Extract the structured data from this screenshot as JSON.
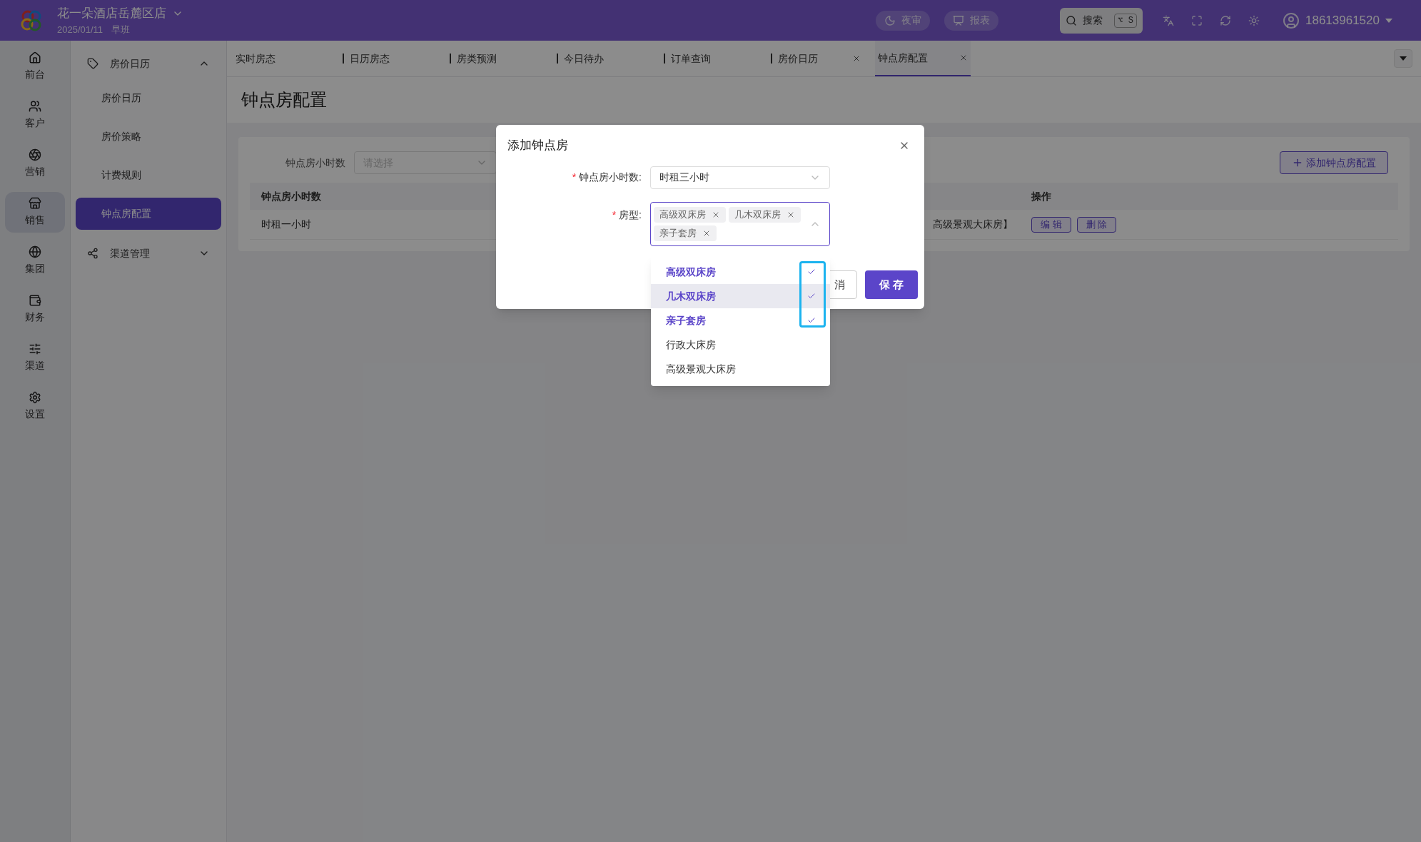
{
  "header": {
    "hotel_name": "花一朵酒店岳麓区店",
    "date": "2025/01/11",
    "shift": "早班",
    "actions": [
      {
        "kind": "night",
        "label": "夜审"
      },
      {
        "kind": "report",
        "label": "报表"
      }
    ],
    "search": {
      "label": "搜索",
      "shortcut": "⌥ S"
    },
    "user": "18613961520"
  },
  "rail": [
    {
      "kind": "front",
      "label": "前台",
      "selected": false
    },
    {
      "kind": "customer",
      "label": "客户",
      "selected": false
    },
    {
      "kind": "marketing",
      "label": "营销",
      "selected": false
    },
    {
      "kind": "sales",
      "label": "销售",
      "selected": true
    },
    {
      "kind": "group",
      "label": "集团",
      "selected": false
    },
    {
      "kind": "finance",
      "label": "财务",
      "selected": false
    },
    {
      "kind": "channel",
      "label": "渠道",
      "selected": false
    },
    {
      "kind": "settings",
      "label": "设置",
      "selected": false
    }
  ],
  "submenu": [
    {
      "kind": "tag",
      "label": "房价日历",
      "expanded": true,
      "children": [
        {
          "label": "房价日历",
          "selected": false
        },
        {
          "label": "房价策略",
          "selected": false
        },
        {
          "label": "计费规则",
          "selected": false
        },
        {
          "label": "钟点房配置",
          "selected": true
        }
      ]
    },
    {
      "kind": "share",
      "label": "渠道管理",
      "expanded": false
    }
  ],
  "tabs": [
    {
      "label": "实时房态",
      "selected": false,
      "closable": false
    },
    {
      "label": "日历房态",
      "selected": false,
      "closable": false
    },
    {
      "label": "房类预测",
      "selected": false,
      "closable": false
    },
    {
      "label": "今日待办",
      "selected": false,
      "closable": false
    },
    {
      "label": "订单查询",
      "selected": false,
      "closable": false
    },
    {
      "label": "房价日历",
      "selected": false,
      "closable": true
    },
    {
      "label": "钟点房配置",
      "selected": true,
      "closable": true
    }
  ],
  "page_title": "钟点房配置",
  "filter": {
    "label": "钟点房小时数",
    "placeholder": "请选择"
  },
  "add_button": "添加钟点房配置",
  "table": {
    "columns": [
      "钟点房小时数",
      "操作"
    ],
    "rows": [
      {
        "hours": "时租一小时",
        "room_types": "高级景观大床房】",
        "actions": [
          "编 辑",
          "删 除"
        ]
      }
    ]
  },
  "dialog": {
    "title": "添加钟点房",
    "hours_field": {
      "label": "钟点房小时数:",
      "required_mark": "*",
      "value": "时租三小时"
    },
    "room_field": {
      "label": "房型:",
      "required_mark": "*",
      "tags": [
        "高级双床房",
        "几木双床房",
        "亲子套房"
      ]
    },
    "options": [
      {
        "label": "高级双床房",
        "selected": true,
        "highlighted": false
      },
      {
        "label": "几木双床房",
        "selected": true,
        "highlighted": true
      },
      {
        "label": "亲子套房",
        "selected": true,
        "highlighted": false
      },
      {
        "label": "行政大床房",
        "selected": false,
        "highlighted": false
      },
      {
        "label": "高级景观大床房",
        "selected": false,
        "highlighted": false
      }
    ],
    "cancel": "消",
    "save": "保 存"
  }
}
